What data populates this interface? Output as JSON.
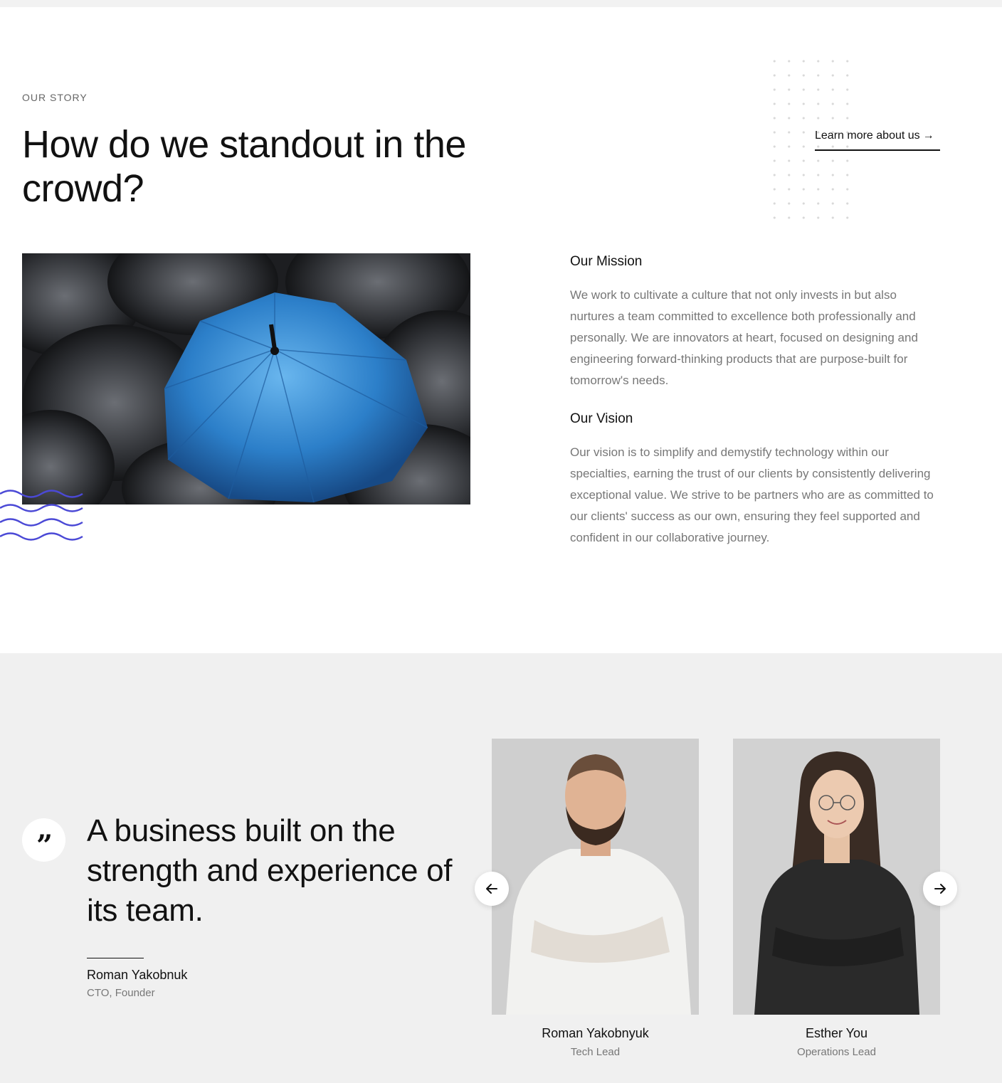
{
  "story": {
    "eyebrow": "OUR STORY",
    "headline": "How do we standout in the crowd?",
    "learn_more": "Learn more about us",
    "learn_more_arrow": "→",
    "mission": {
      "title": "Our Mission",
      "text": "We work to cultivate a culture that not only invests in but also nurtures a team committed to excellence both professionally and personally. We are innovators at heart, focused on designing and engineering forward-thinking products that are purpose-built for tomorrow's needs."
    },
    "vision": {
      "title": "Our Vision",
      "text": "Our vision is to simplify and demystify technology within our specialties, earning the trust of our clients by consistently delivering exceptional value. We strive to be partners who are as committed to our clients' success as our own, ensuring they feel supported and confident in our collaborative journey."
    },
    "accent_color": "#4b49d6"
  },
  "team": {
    "quote_mark": "”",
    "quote": "A business built on the strength and experience of its team.",
    "quote_author": "Roman Yakobnuk",
    "quote_author_role": "CTO, Founder",
    "members": [
      {
        "name": "Roman Yakobnyuk",
        "role": "Tech Lead"
      },
      {
        "name": "Esther You",
        "role": "Operations Lead"
      }
    ]
  }
}
